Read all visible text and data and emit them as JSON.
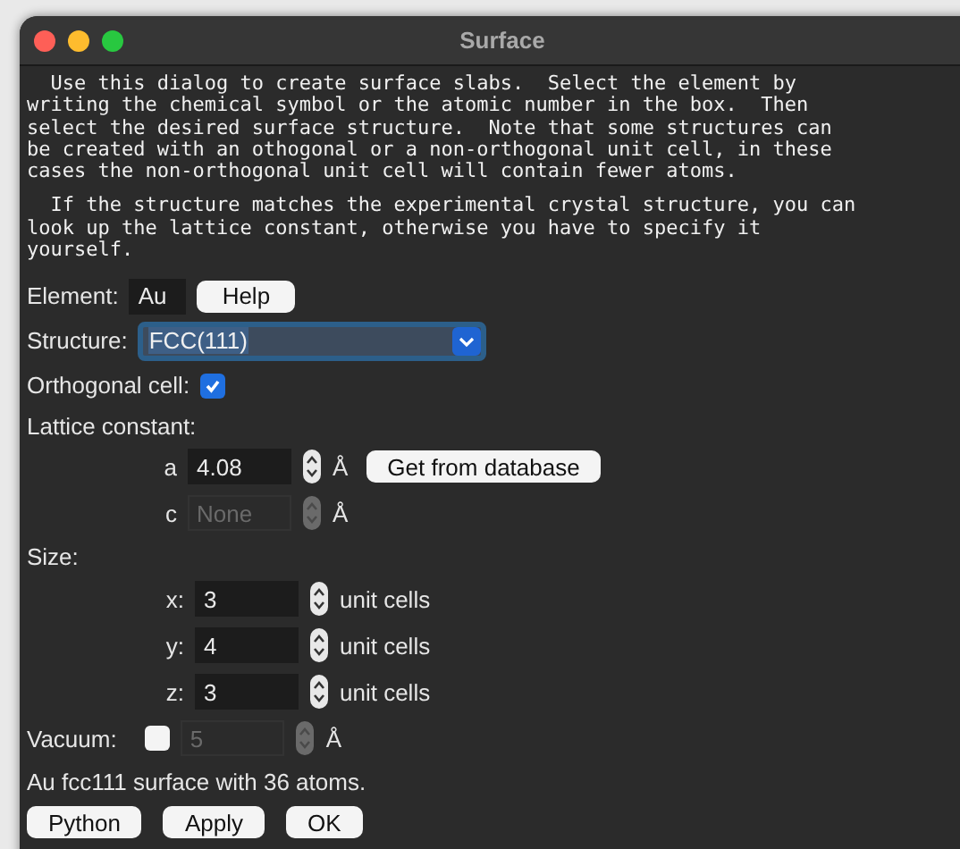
{
  "window": {
    "title": "Surface"
  },
  "intro": [
    "  Use this dialog to create surface slabs.  Select the element by\nwriting the chemical symbol or the atomic number in the box.  Then\nselect the desired surface structure.  Note that some structures can\nbe created with an othogonal or a non-orthogonal unit cell, in these\ncases the non-orthogonal unit cell will contain fewer atoms.",
    "  If the structure matches the experimental crystal structure, you can\nlook up the lattice constant, otherwise you have to specify it\nyourself."
  ],
  "element": {
    "label": "Element:",
    "value": "Au"
  },
  "help_button": "Help",
  "structure": {
    "label": "Structure:",
    "value": "FCC(111)"
  },
  "orthogonal": {
    "label": "Orthogonal cell:",
    "checked": true
  },
  "lattice": {
    "label": "Lattice constant:",
    "params": [
      {
        "name": "a",
        "value": "4.08",
        "unit": "Å",
        "disabled": false
      },
      {
        "name": "c",
        "value": "None",
        "unit": "Å",
        "disabled": true
      }
    ]
  },
  "get_button": "Get from database",
  "size": {
    "label": "Size:",
    "dims": [
      {
        "name": "x:",
        "value": "3",
        "unit": "unit cells"
      },
      {
        "name": "y:",
        "value": "4",
        "unit": "unit cells"
      },
      {
        "name": "z:",
        "value": "3",
        "unit": "unit cells"
      }
    ]
  },
  "vacuum": {
    "label": "Vacuum:",
    "checked": false,
    "value": "5",
    "unit": "Å",
    "disabled": true
  },
  "status": "Au fcc111 surface with 36 atoms.",
  "buttons": [
    "Python",
    "Apply",
    "OK"
  ]
}
